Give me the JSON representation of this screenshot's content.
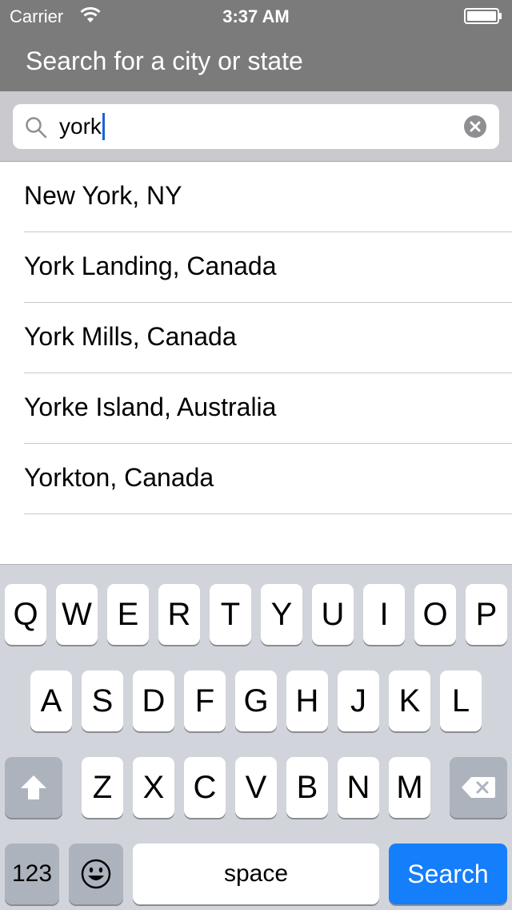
{
  "status_bar": {
    "carrier": "Carrier",
    "time": "3:37 AM",
    "wifi_icon": "wifi-icon",
    "battery_icon": "battery-icon"
  },
  "header": {
    "title": "Search for a city or state"
  },
  "search": {
    "value": "york",
    "search_icon": "magnifier-icon",
    "clear_icon": "clear-x-icon"
  },
  "results": [
    {
      "label": "New York, NY"
    },
    {
      "label": "York Landing, Canada"
    },
    {
      "label": "York Mills, Canada"
    },
    {
      "label": "Yorke Island, Australia"
    },
    {
      "label": "Yorkton, Canada"
    }
  ],
  "keyboard": {
    "row1": [
      "Q",
      "W",
      "E",
      "R",
      "T",
      "Y",
      "U",
      "I",
      "O",
      "P"
    ],
    "row2": [
      "A",
      "S",
      "D",
      "F",
      "G",
      "H",
      "J",
      "K",
      "L"
    ],
    "row3": [
      "Z",
      "X",
      "C",
      "V",
      "B",
      "N",
      "M"
    ],
    "numbers_label": "123",
    "space_label": "space",
    "search_label": "Search",
    "shift_icon": "shift-arrow-icon",
    "delete_icon": "backspace-icon",
    "emoji_icon": "emoji-face-icon"
  },
  "colors": {
    "header_bg": "#7b7b7b",
    "search_bar_bg": "#c9c9ce",
    "keyboard_bg": "#d1d5db",
    "accent_blue": "#147efb",
    "caret": "#1a63d6"
  }
}
